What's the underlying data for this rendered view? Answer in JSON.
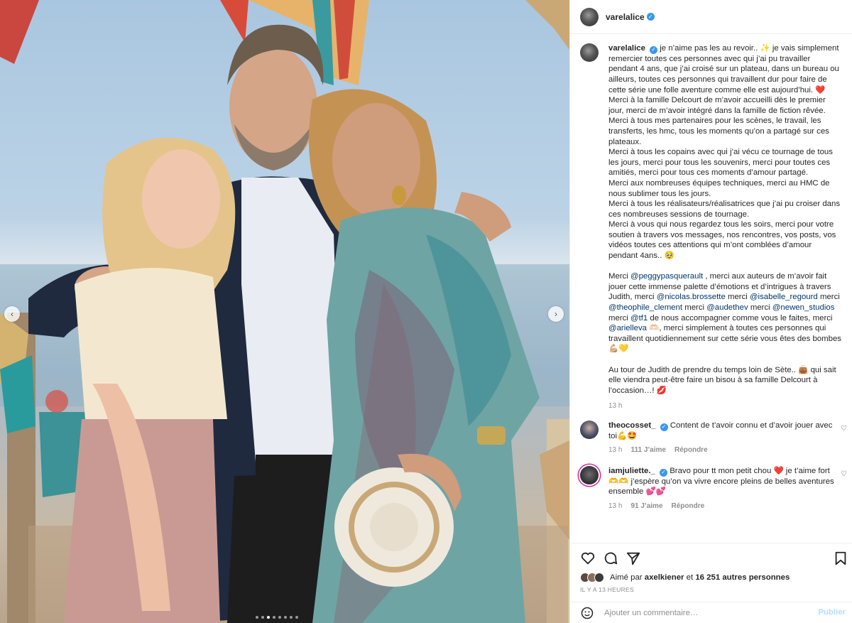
{
  "post": {
    "username": "varelalice",
    "verified": true,
    "photo_alt": "Trois personnes posant devant la plage",
    "carousel": {
      "count": 8,
      "active": 2
    }
  },
  "caption": {
    "username": "varelalice",
    "line1": "je n’aime pas les au revoir.. ✨ je vais simplement remercier toutes ces personnes avec qui j’ai pu travailler pendant 4 ans, que j’ai croisé sur un plateau, dans un bureau ou ailleurs, toutes ces personnes qui travaillent dur pour faire de cette série une folle aventure comme elle est aujourd’hui. ❤️",
    "p2": "Merci à la famille Delcourt de m’avoir accueilli dès le premier jour, merci de m’avoir intégré dans la famille de fiction rêvée.",
    "p3": "Merci à tous mes partenaires pour les scènes, le travail, les transferts, les hmc, tous les moments qu’on a partagé sur ces plateaux.",
    "p4": "Merci à tous les copains avec qui j’ai vécu ce tournage de tous les jours, merci pour tous les souvenirs, merci pour toutes ces amitiés, merci pour tous ces moments d’amour partagé.",
    "p5": "Merci aux nombreuses équipes techniques, merci au HMC de nous sublimer tous les jours.",
    "p6": "Merci à tous les réalisateurs/réalisatrices que j’ai pu croiser dans ces nombreuses sessions de tournage.",
    "p7": "Merci à vous qui nous regardez tous les soirs, merci pour votre soutien à travers vos messages, nos rencontres, vos posts, vos vidéos toutes ces attentions qui m’ont comblées d’amour pendant 4ans.. 🥹",
    "m_intro": "Merci",
    "m1": "@peggypasquerault",
    "m1_after": ", merci aux auteurs de m’avoir fait jouer cette immense palette d’émotions et d’intrigues à travers Judith, merci",
    "m2": "@nicolas.brossette",
    "merci": "merci",
    "m3": "@isabelle_regourd",
    "m4": "@theophile_clement",
    "m5": "@audethev",
    "m6": "@newen_studios",
    "m7": "@tf1",
    "m7_after": "de nous accompagner comme vous le faites, merci",
    "m8": "@arielleva",
    "m8_after": "🫶🏻, merci simplement à toutes ces personnes qui travaillent quotidiennement sur cette série vous êtes des bombes 💪🏼💛",
    "p9": "Au tour de Judith de prendre du temps loin de Sète.. 👜 qui sait elle viendra peut-être faire un bisou à sa famille Delcourt à l’occasion…! 💋",
    "time": "13 h"
  },
  "comments": [
    {
      "username": "theocosset_",
      "text": "Content de t’avoir connu et d’avoir jouer avec toi💪🤩",
      "time": "13 h",
      "likes": "111 J’aime",
      "reply": "Répondre"
    },
    {
      "username": "iamjuliette._",
      "text": "Bravo pour tt mon petit chou ❤️ je t’aime fort 🫶🫶 j’espère qu’on va vivre encore pleins de belles aventures ensemble 💕💕",
      "time": "13 h",
      "likes": "91 J’aime",
      "reply": "Répondre"
    }
  ],
  "likes": {
    "prefix": "Aimé par",
    "user": "axelkiener",
    "mid": "et",
    "count": "16 251 autres personnes"
  },
  "posted_ago": "IL Y A 13 HEURES",
  "add_comment": {
    "placeholder": "Ajouter un commentaire…",
    "publish": "Publier"
  },
  "icons": {
    "like": "heart-icon",
    "comment": "comment-icon",
    "share": "share-icon",
    "save": "bookmark-icon",
    "emoji": "emoji-icon"
  },
  "colors": {
    "link": "#00376b",
    "verified": "#3897f0",
    "muted": "#8e8e8e",
    "publish": "#b2dffc"
  }
}
